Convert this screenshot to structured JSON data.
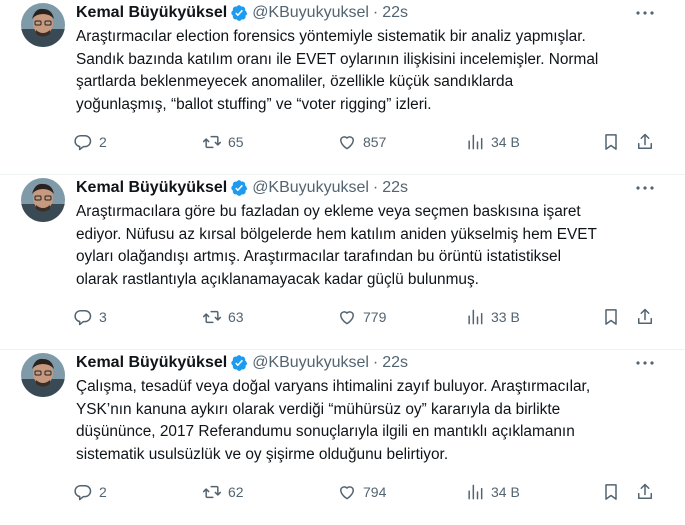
{
  "tweets": [
    {
      "author": {
        "name": "Kemal Büyükyüksel",
        "handle": "@KBuyukyuksel",
        "separator": "·",
        "time": "22s"
      },
      "text": "Araştırmacılar election forensics yöntemiyle sistematik bir analiz yapmışlar.\nSandık bazında katılım oranı ile EVET oylarının ilişkisini incelemişler. Normal\nşartlarda beklenmeyecek anomaliler, özellikle küçük sandıklarda\nyoğunlaşmış, “ballot stuffing” ve “voter rigging” izleri.",
      "stats": {
        "replies": "2",
        "retweets": "65",
        "likes": "857",
        "views": "34 B"
      }
    },
    {
      "author": {
        "name": "Kemal Büyükyüksel",
        "handle": "@KBuyukyuksel",
        "separator": "·",
        "time": "22s"
      },
      "text": "Araştırmacılara göre bu fazladan oy ekleme veya seçmen baskısına işaret\nediyor. Nüfusu az kırsal bölgelerde hem katılım aniden yükselmiş hem EVET\noyları olağandışı artmış. Araştırmacılar tarafından bu örüntü istatistiksel\nolarak rastlantıyla açıklanamayacak kadar güçlü bulunmuş.",
      "stats": {
        "replies": "3",
        "retweets": "63",
        "likes": "779",
        "views": "33 B"
      }
    },
    {
      "author": {
        "name": "Kemal Büyükyüksel",
        "handle": "@KBuyukyuksel",
        "separator": "·",
        "time": "22s"
      },
      "text": "Çalışma, tesadüf veya doğal varyans ihtimalini zayıf buluyor. Araştırmacılar,\nYSK’nın kanuna aykırı olarak verdiği “mühürsüz oy” kararıyla da birlikte\ndüşününce, 2017 Referandumu sonuçlarıyla ilgili en mantıklı açıklamanın\nsistematik usulsüzlük ve oy şişirme olduğunu belirtiyor.",
      "stats": {
        "replies": "2",
        "retweets": "62",
        "likes": "794",
        "views": "34 B"
      }
    }
  ],
  "icons": {
    "verified": "verified-badge-icon",
    "more": "more-dots-icon",
    "reply": "reply-icon",
    "retweet": "retweet-icon",
    "like": "heart-icon",
    "views": "views-chart-icon",
    "bookmark": "bookmark-icon",
    "share": "share-icon"
  },
  "colors": {
    "verified": "#1d9bf0",
    "text": "#0f1419",
    "secondary": "#536471",
    "divider": "#eff3f4"
  }
}
